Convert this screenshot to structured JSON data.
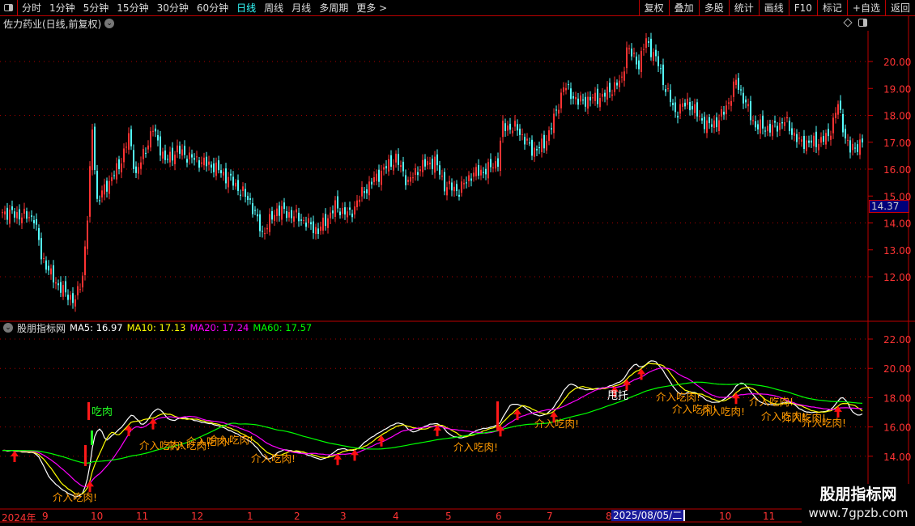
{
  "toolbar": {
    "periods": [
      "分时",
      "1分钟",
      "5分钟",
      "15分钟",
      "30分钟",
      "60分钟",
      "日线",
      "周线",
      "月线",
      "多周期",
      "更多 >"
    ],
    "active_period": "日线",
    "actions": [
      "复权",
      "叠加",
      "多股",
      "统计",
      "画线",
      "F10",
      "标记",
      "+自选",
      "返回"
    ]
  },
  "stock": {
    "title": "佐力药业(日线,前复权)",
    "last_price_tag": "14.37"
  },
  "price_axis": {
    "ticks": [
      "20.00",
      "19.00",
      "18.00",
      "17.00",
      "16.00",
      "15.00",
      "14.00",
      "13.00",
      "12.00"
    ],
    "range": [
      11,
      21
    ]
  },
  "indicator": {
    "name": "股朋指标网",
    "ma": [
      {
        "label": "MA5: 16.97",
        "color": "#ffffff"
      },
      {
        "label": "MA10: 17.13",
        "color": "#ffff00"
      },
      {
        "label": "MA20: 17.24",
        "color": "#ff00ff"
      },
      {
        "label": "MA60: 17.57",
        "color": "#00ff00"
      }
    ],
    "axis_ticks": [
      "22.00",
      "20.00",
      "18.00",
      "16.00",
      "14.00"
    ],
    "signal_text": "介入吃肉!",
    "eat_text": "吃肉",
    "white_text": "甩托",
    "arrow_days": [
      5,
      36,
      52,
      62,
      138,
      145,
      156,
      179,
      205,
      212,
      227,
      252,
      257,
      263,
      302,
      344
    ],
    "signal_labels": [
      "介入吃肉!",
      "介入吃肉!",
      "介入吃肉!",
      "介入吃肉!",
      "介入吃肉!",
      "介入吃肉!",
      "介入吃肉!",
      "介入吃肉!",
      "介入吃肉!",
      "介入吃肉!",
      "介入吃肉!",
      "介入吃肉!",
      "介入吃肉!",
      "介入吃肉!",
      "介入吃肉!"
    ]
  },
  "time_axis": {
    "labels": [
      "2024年",
      "9",
      "10",
      "11",
      "12",
      "1",
      "2",
      "3",
      "4",
      "5",
      "6",
      "7",
      "8",
      "10",
      "11"
    ],
    "cursor_date": "2025/08/05/二"
  },
  "watermark": {
    "title": "股朋指标网",
    "url": "www.7gpzb.com"
  },
  "colors": {
    "up": "#ff3333",
    "down": "#54ffff",
    "grid": "#b00000"
  },
  "chart_data": {
    "type": "candlestick",
    "path_waypoints": [
      [
        0,
        14.4
      ],
      [
        13,
        14.2
      ],
      [
        16,
        12.8
      ],
      [
        20,
        12.05
      ],
      [
        25,
        11.45
      ],
      [
        30,
        11.1
      ],
      [
        33,
        12.05
      ],
      [
        35,
        14.2
      ],
      [
        37,
        17.5
      ],
      [
        39,
        14.8
      ],
      [
        43,
        15.4
      ],
      [
        48,
        16.1
      ],
      [
        52,
        17.2
      ],
      [
        55,
        15.8
      ],
      [
        62,
        17.5
      ],
      [
        67,
        16.3
      ],
      [
        72,
        16.7
      ],
      [
        78,
        16.4
      ],
      [
        87,
        16.1
      ],
      [
        95,
        15.5
      ],
      [
        102,
        14.8
      ],
      [
        107,
        13.6
      ],
      [
        113,
        14.5
      ],
      [
        122,
        14.2
      ],
      [
        130,
        13.7
      ],
      [
        137,
        14.6
      ],
      [
        143,
        14.3
      ],
      [
        148,
        15.1
      ],
      [
        157,
        16.0
      ],
      [
        162,
        16.4
      ],
      [
        167,
        15.5
      ],
      [
        172,
        16.1
      ],
      [
        178,
        16.3
      ],
      [
        182,
        15.4
      ],
      [
        188,
        15.2
      ],
      [
        193,
        15.8
      ],
      [
        200,
        16.0
      ],
      [
        204,
        16.3
      ],
      [
        206,
        17.6
      ],
      [
        212,
        17.5
      ],
      [
        218,
        16.7
      ],
      [
        223,
        16.9
      ],
      [
        228,
        18.1
      ],
      [
        231,
        19.1
      ],
      [
        237,
        18.5
      ],
      [
        247,
        18.7
      ],
      [
        255,
        19.3
      ],
      [
        257,
        20.5
      ],
      [
        262,
        19.9
      ],
      [
        265,
        20.8
      ],
      [
        270,
        19.9
      ],
      [
        273,
        19.0
      ],
      [
        277,
        18.1
      ],
      [
        282,
        18.5
      ],
      [
        290,
        17.6
      ],
      [
        295,
        17.8
      ],
      [
        300,
        18.7
      ],
      [
        302,
        19.3
      ],
      [
        306,
        18.4
      ],
      [
        310,
        17.6
      ],
      [
        317,
        17.5
      ],
      [
        322,
        17.8
      ],
      [
        328,
        17.0
      ],
      [
        335,
        17.0
      ],
      [
        340,
        17.2
      ],
      [
        344,
        18.4
      ],
      [
        347,
        17.2
      ],
      [
        349,
        16.7
      ],
      [
        354,
        17.0
      ]
    ]
  }
}
